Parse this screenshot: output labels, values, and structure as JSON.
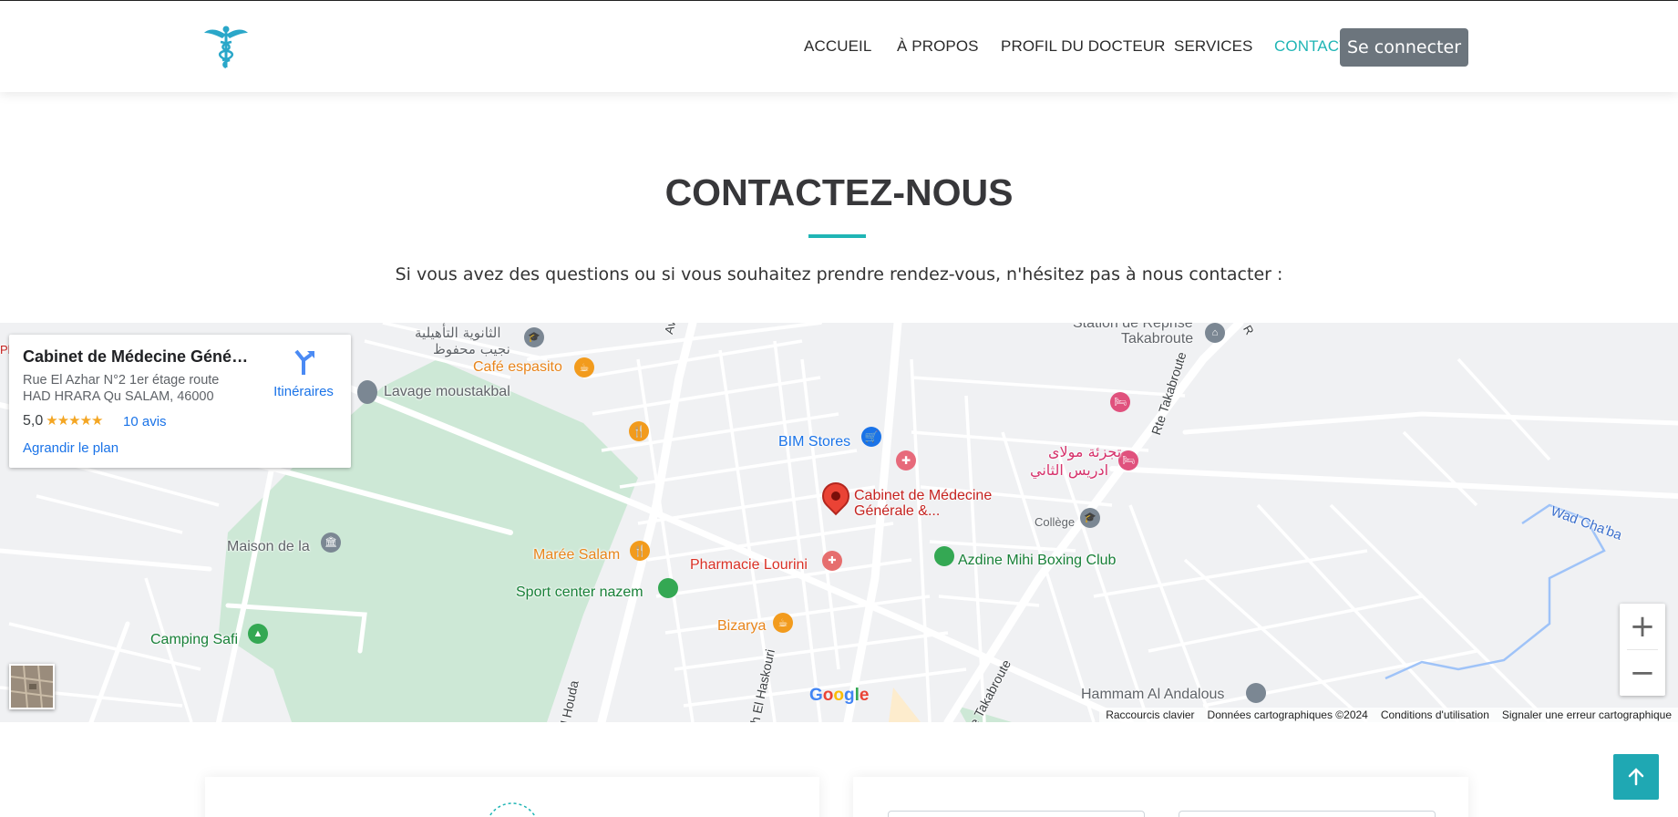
{
  "nav": {
    "items": [
      {
        "label": "ACCUEIL",
        "active": false
      },
      {
        "label": "À PROPOS",
        "active": false
      },
      {
        "label": "PROFIL DU DOCTEUR",
        "active": false
      },
      {
        "label": "SERVICES",
        "active": false
      },
      {
        "label": "CONTACT",
        "active": true
      }
    ],
    "login_label": "Se connecter"
  },
  "section": {
    "title": "CONTACTEZ-NOUS",
    "subtitle": "Si vous avez des questions ou si vous souhaitez prendre rendez-vous, n'hésitez pas à nous contacter :"
  },
  "map": {
    "place": {
      "name": "Cabinet de Médecine Généra...",
      "address_line1": "Rue El Azhar N°2 1er étage route",
      "address_line2": "HAD HRARA Qu SALAM, 46000",
      "rating": "5,0",
      "stars": "★★★★★",
      "reviews": "10 avis",
      "enlarge": "Agrandir le plan",
      "directions": "Itinéraires"
    },
    "labels": {
      "school_ar_1": "الثانوية التأهيلية",
      "school_ar_2": "نجيب محفوظ",
      "cafe": "Café espasito",
      "lavage": "Lavage moustakbal",
      "station_1": "Station de Reprise",
      "station_2": "Takabroute",
      "bim": "BIM Stores",
      "cabinet_1": "Cabinet de Médecine",
      "cabinet_2": "Générale &...",
      "tajzia_1": "تجزئة مولاى",
      "tajzia_2": "ادريس الثاني",
      "college": "Collège",
      "rte_takabroute": "Rte Takabroute",
      "wad": "Wad Cha'ba",
      "maison": "Maison de la",
      "maree": "Marée Salam",
      "pharmacie": "Pharmacie Lourini",
      "azdine": "Azdine Mihi Boxing Club",
      "sport": "Sport center nazem",
      "camping": "Camping Safi",
      "bizarya": "Bizarya",
      "haskouri": "h El Haskouri",
      "takabroute_bottom": "e Takabroute",
      "houda": "l Houda",
      "hammam": "Hammam Al Andalous",
      "av": "Av",
      "ph": "Ph",
      "r": "R"
    },
    "google": "Google",
    "attribution": [
      "Raccourcis clavier",
      "Données cartographiques ©2024",
      "Conditions d'utilisation",
      "Signaler une erreur cartographique"
    ],
    "zoom_in": "+",
    "zoom_out": "−"
  },
  "colors": {
    "accent": "#1fb5b5",
    "login_bg": "#6c757d",
    "map_bg": "#f0f1f3",
    "park": "#cde8d6",
    "road": "#ffffff",
    "pin_red": "#ea4335",
    "food": "#f29b1d",
    "blue_poi": "#1a73e8",
    "green_poi": "#34a853"
  }
}
